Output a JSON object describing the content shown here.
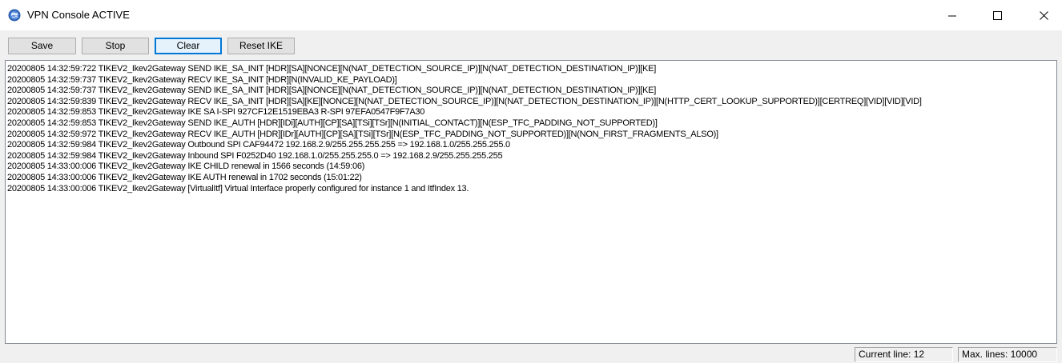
{
  "window": {
    "title": "VPN Console ACTIVE",
    "icon": "globe-shield-icon"
  },
  "toolbar": {
    "save_label": "Save",
    "stop_label": "Stop",
    "clear_label": "Clear",
    "reset_ike_label": "Reset IKE"
  },
  "log": {
    "lines": [
      "20200805 14:32:59:722 TIKEV2_Ikev2Gateway SEND IKE_SA_INIT [HDR][SA][NONCE][N(NAT_DETECTION_SOURCE_IP)][N(NAT_DETECTION_DESTINATION_IP)][KE]",
      "20200805 14:32:59:737 TIKEV2_Ikev2Gateway RECV IKE_SA_INIT [HDR][N(INVALID_KE_PAYLOAD)]",
      "20200805 14:32:59:737 TIKEV2_Ikev2Gateway SEND IKE_SA_INIT [HDR][SA][NONCE][N(NAT_DETECTION_SOURCE_IP)][N(NAT_DETECTION_DESTINATION_IP)][KE]",
      "20200805 14:32:59:839 TIKEV2_Ikev2Gateway RECV IKE_SA_INIT [HDR][SA][KE][NONCE][N(NAT_DETECTION_SOURCE_IP)][N(NAT_DETECTION_DESTINATION_IP)][N(HTTP_CERT_LOOKUP_SUPPORTED)][CERTREQ][VID][VID][VID]",
      "20200805 14:32:59:853 TIKEV2_Ikev2Gateway IKE SA I-SPI 927CF12E1519EBA3 R-SPI 97EFA0547F9F7A30",
      "20200805 14:32:59:853 TIKEV2_Ikev2Gateway SEND IKE_AUTH [HDR][IDi][AUTH][CP][SA][TSi][TSr][N(INITIAL_CONTACT)][N(ESP_TFC_PADDING_NOT_SUPPORTED)]",
      "20200805 14:32:59:972 TIKEV2_Ikev2Gateway RECV IKE_AUTH [HDR][IDr][AUTH][CP][SA][TSi][TSr][N(ESP_TFC_PADDING_NOT_SUPPORTED)][N(NON_FIRST_FRAGMENTS_ALSO)]",
      "20200805 14:32:59:984 TIKEV2_Ikev2Gateway Outbound SPI CAF94472 192.168.2.9/255.255.255.255 => 192.168.1.0/255.255.255.0",
      "20200805 14:32:59:984 TIKEV2_Ikev2Gateway Inbound  SPI F0252D40 192.168.1.0/255.255.255.0 => 192.168.2.9/255.255.255.255",
      "20200805 14:33:00:006 TIKEV2_Ikev2Gateway IKE CHILD renewal in 1566 seconds (14:59:06)",
      "20200805 14:33:00:006 TIKEV2_Ikev2Gateway IKE AUTH renewal in 1702 seconds (15:01:22)",
      "20200805 14:33:00:006 TIKEV2_Ikev2Gateway [VirtualItf] Virtual Interface properly configured for instance 1 and ItfIndex 13."
    ]
  },
  "status": {
    "current_line": "Current line: 12",
    "max_lines": "Max. lines: 10000"
  },
  "colors": {
    "focus_border": "#0078d7",
    "window_bg": "#f0f0f0"
  }
}
